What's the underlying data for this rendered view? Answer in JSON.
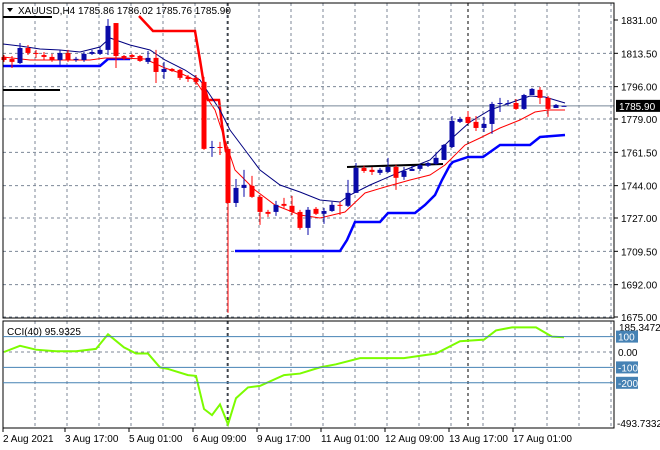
{
  "header": {
    "symbol": "XAUUSD,H4",
    "ohlc": "1785.86 1786.02 1785.76 1785.90"
  },
  "price_axis": {
    "labels": [
      "1831.00",
      "1813.50",
      "1796.00",
      "1779.00",
      "1761.50",
      "1744.00",
      "1727.00",
      "1709.50",
      "1692.00",
      "1675.00"
    ],
    "current_price": "1785.90"
  },
  "indicator": {
    "label": "CCI(40) 95.9325",
    "max_label": "185.3472",
    "min_label": "-493.7332",
    "levels": [
      "100",
      "0.00",
      "-100",
      "-200"
    ]
  },
  "time_axis": {
    "labels": [
      "2 Aug 2021",
      "3 Aug 17:00",
      "5 Aug 01:00",
      "6 Aug 09:00",
      "9 Aug 17:00",
      "11 Aug 01:00",
      "12 Aug 09:00",
      "13 Aug 17:00",
      "17 Aug 01:00"
    ]
  },
  "colors": {
    "bull": "#0a0aa8",
    "bear": "#ff0000",
    "cci": "#7cfc00",
    "level": "#4682b4",
    "current_bg": "#000000"
  },
  "chart_data": {
    "type": "candlestick",
    "symbol": "XAUUSD",
    "timeframe": "H4",
    "ylim": [
      1675,
      1831
    ],
    "yticks": [
      1831,
      1813.5,
      1796,
      1779,
      1761.5,
      1744,
      1727,
      1709.5,
      1692,
      1675
    ],
    "ohlc_fields": [
      "open",
      "high",
      "low",
      "close"
    ],
    "candles": [
      [
        1811.6,
        1812.6,
        1809.0,
        1810.0
      ],
      [
        1810.5,
        1812.1,
        1805.8,
        1809.0
      ],
      [
        1808.4,
        1818.9,
        1807.9,
        1816.3
      ],
      [
        1816.3,
        1817.9,
        1812.6,
        1813.7
      ],
      [
        1813.7,
        1815.3,
        1811.1,
        1813.2
      ],
      [
        1812.6,
        1814.2,
        1810.0,
        1811.6
      ],
      [
        1811.6,
        1813.2,
        1809.0,
        1810.0
      ],
      [
        1810.0,
        1815.3,
        1807.4,
        1813.7
      ],
      [
        1813.7,
        1815.3,
        1809.0,
        1810.0
      ],
      [
        1810.5,
        1811.6,
        1809.0,
        1810.6
      ],
      [
        1810.0,
        1814.2,
        1809.0,
        1813.2
      ],
      [
        1813.2,
        1815.3,
        1812.6,
        1814.2
      ],
      [
        1813.2,
        1816.8,
        1812.6,
        1815.3
      ],
      [
        1815.3,
        1831.5,
        1812.6,
        1827.9
      ],
      [
        1829.4,
        1829.4,
        1805.8,
        1812.1
      ],
      [
        1812.1,
        1812.6,
        1810.0,
        1811.1
      ],
      [
        1812.6,
        1813.2,
        1811.1,
        1811.6
      ],
      [
        1812.1,
        1812.6,
        1809.0,
        1809.5
      ],
      [
        1809.0,
        1814.7,
        1807.9,
        1811.1
      ],
      [
        1811.1,
        1815.3,
        1797.9,
        1803.7
      ],
      [
        1803.7,
        1809.0,
        1800.0,
        1805.3
      ],
      [
        1805.3,
        1805.8,
        1803.7,
        1804.2
      ],
      [
        1804.8,
        1805.3,
        1799.5,
        1800.6
      ],
      [
        1801.1,
        1802.1,
        1798.5,
        1800.0
      ],
      [
        1800.6,
        1802.1,
        1796.9,
        1798.5
      ],
      [
        1798.5,
        1801.1,
        1762.8,
        1763.3
      ],
      [
        1763.8,
        1767.5,
        1759.1,
        1764.3
      ],
      [
        1764.3,
        1767.0,
        1760.1,
        1763.8
      ],
      [
        1763.3,
        1764.3,
        1677.2,
        1734.9
      ],
      [
        1734.9,
        1747.5,
        1732.8,
        1742.8
      ],
      [
        1742.8,
        1752.3,
        1738.1,
        1744.4
      ],
      [
        1743.9,
        1749.1,
        1737.6,
        1738.1
      ],
      [
        1738.1,
        1739.1,
        1723.4,
        1730.2
      ],
      [
        1730.2,
        1731.3,
        1727.6,
        1729.2
      ],
      [
        1730.2,
        1736.0,
        1728.1,
        1733.9
      ],
      [
        1734.4,
        1737.6,
        1732.3,
        1733.4
      ],
      [
        1733.4,
        1738.6,
        1728.6,
        1730.2
      ],
      [
        1730.2,
        1731.3,
        1720.8,
        1721.8
      ],
      [
        1721.8,
        1732.8,
        1718.1,
        1731.3
      ],
      [
        1731.8,
        1732.8,
        1728.6,
        1729.2
      ],
      [
        1729.2,
        1732.3,
        1723.9,
        1730.7
      ],
      [
        1730.7,
        1735.5,
        1730.2,
        1733.9
      ],
      [
        1733.9,
        1735.5,
        1728.6,
        1733.4
      ],
      [
        1733.4,
        1747.0,
        1732.8,
        1740.2
      ],
      [
        1740.2,
        1755.9,
        1740.2,
        1753.3
      ],
      [
        1753.3,
        1754.4,
        1750.7,
        1751.7
      ],
      [
        1752.3,
        1753.8,
        1749.6,
        1751.2
      ],
      [
        1750.7,
        1753.3,
        1749.6,
        1752.3
      ],
      [
        1751.2,
        1758.6,
        1750.7,
        1753.8
      ],
      [
        1753.8,
        1754.9,
        1741.8,
        1748.1
      ],
      [
        1748.6,
        1753.8,
        1747.0,
        1751.7
      ],
      [
        1751.7,
        1754.4,
        1751.7,
        1752.8
      ],
      [
        1752.8,
        1755.4,
        1751.7,
        1754.9
      ],
      [
        1754.4,
        1756.5,
        1753.8,
        1755.9
      ],
      [
        1755.4,
        1761.2,
        1754.9,
        1758.6
      ],
      [
        1757.5,
        1765.9,
        1757.5,
        1765.4
      ],
      [
        1764.3,
        1780.6,
        1763.8,
        1778.0
      ],
      [
        1777.5,
        1780.1,
        1776.9,
        1779.0
      ],
      [
        1780.1,
        1783.2,
        1776.4,
        1776.9
      ],
      [
        1777.5,
        1780.6,
        1772.7,
        1774.3
      ],
      [
        1774.3,
        1780.1,
        1772.2,
        1776.4
      ],
      [
        1776.4,
        1788.0,
        1771.2,
        1786.9
      ],
      [
        1786.9,
        1790.1,
        1782.7,
        1787.4
      ],
      [
        1786.9,
        1789.0,
        1785.9,
        1787.4
      ],
      [
        1787.4,
        1789.5,
        1783.8,
        1784.3
      ],
      [
        1784.3,
        1792.2,
        1783.8,
        1791.6
      ],
      [
        1791.6,
        1795.3,
        1791.6,
        1794.8
      ],
      [
        1794.3,
        1795.8,
        1786.9,
        1790.1
      ],
      [
        1790.1,
        1791.1,
        1780.1,
        1784.3
      ],
      [
        1784.8,
        1786.9,
        1784.8,
        1786.4
      ],
      [
        1785.86,
        1786.02,
        1785.76,
        1785.9
      ]
    ],
    "cci": {
      "name": "CCI(40)",
      "ylim": [
        -493.7332,
        185.3472
      ],
      "levels": [
        100,
        0,
        -100,
        -200
      ],
      "points": [
        [
          0,
          0
        ],
        [
          2,
          40
        ],
        [
          4,
          15
        ],
        [
          6.5,
          5
        ],
        [
          9,
          5
        ],
        [
          11.5,
          20
        ],
        [
          13,
          115
        ],
        [
          15,
          30
        ],
        [
          16.5,
          -10
        ],
        [
          18,
          -10
        ],
        [
          19.5,
          -100
        ],
        [
          20.5,
          -110
        ],
        [
          23,
          -150
        ],
        [
          24,
          -155
        ],
        [
          25,
          -370
        ],
        [
          26,
          -410
        ],
        [
          27,
          -340
        ],
        [
          28,
          -470
        ],
        [
          29,
          -300
        ],
        [
          30.5,
          -230
        ],
        [
          32,
          -220
        ],
        [
          35,
          -150
        ],
        [
          37,
          -140
        ],
        [
          39.5,
          -100
        ],
        [
          41.5,
          -80
        ],
        [
          44.5,
          -40
        ],
        [
          50,
          -40
        ],
        [
          54,
          -10
        ],
        [
          55.5,
          30
        ],
        [
          57,
          70
        ],
        [
          60,
          80
        ],
        [
          61.5,
          140
        ],
        [
          63.5,
          160
        ],
        [
          66.5,
          160
        ],
        [
          68.5,
          100
        ],
        [
          70,
          95.9325
        ]
      ]
    }
  }
}
